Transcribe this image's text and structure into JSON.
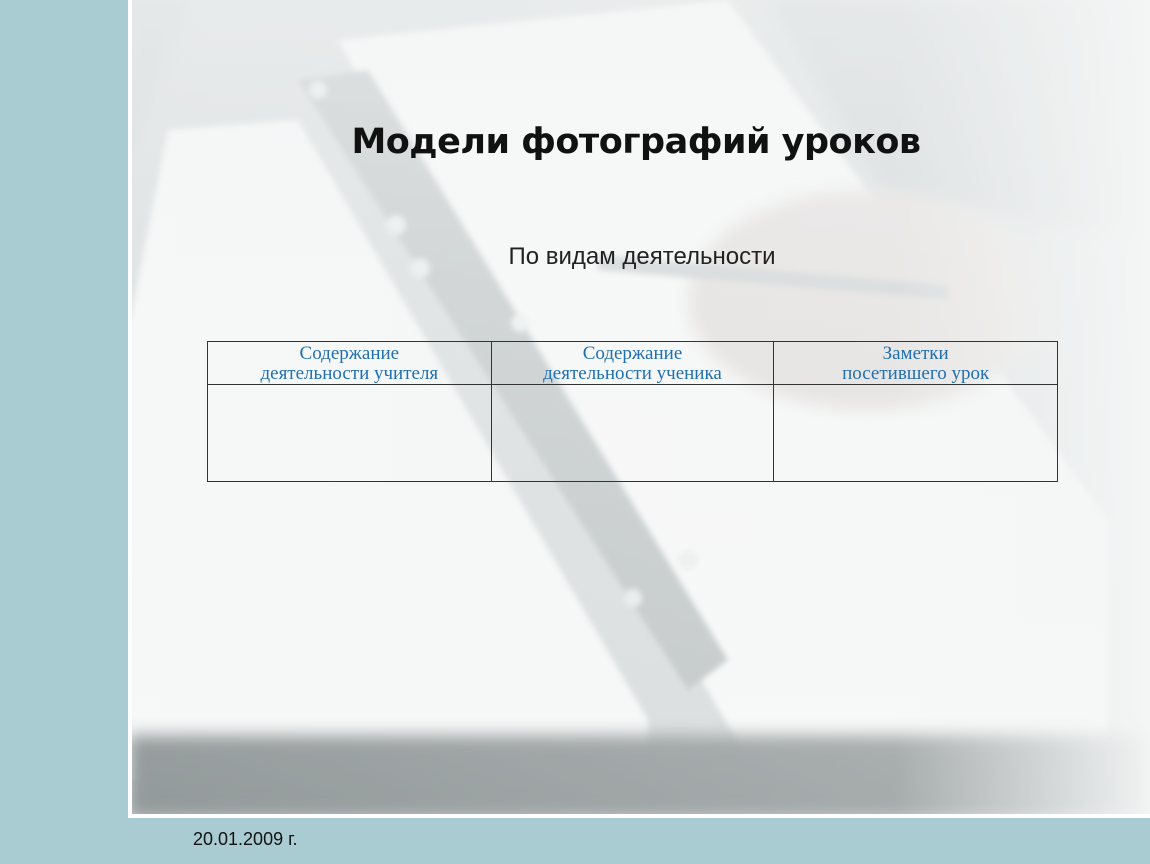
{
  "slide": {
    "title": "Модели фотографий уроков",
    "subtitle": "По видам деятельности",
    "table": {
      "headers": [
        "Содержание\nдеятельности учителя",
        "Содержание\nдеятельности ученика",
        "Заметки\nпосетившего урок"
      ],
      "rows": [
        [
          "",
          "",
          ""
        ]
      ]
    },
    "footer_date": "20.01.2009 г."
  },
  "colors": {
    "side_band": "#a9ccd3",
    "header_text": "#1f6fb2",
    "title_text": "#111111"
  }
}
